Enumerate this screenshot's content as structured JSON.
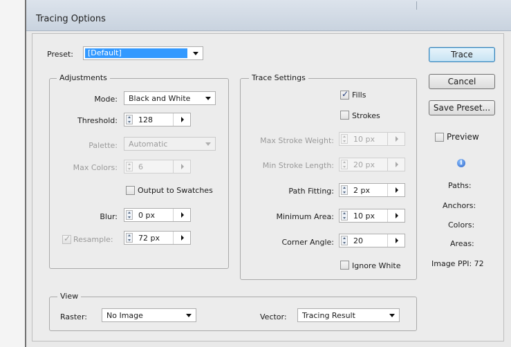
{
  "window": {
    "title": "Tracing Options"
  },
  "preset": {
    "label": "Preset:",
    "value": "[Default]"
  },
  "adjustments": {
    "title": "Adjustments",
    "mode": {
      "label": "Mode:",
      "value": "Black and White"
    },
    "threshold": {
      "label": "Threshold:",
      "value": "128"
    },
    "palette": {
      "label": "Palette:",
      "value": "Automatic"
    },
    "max_colors": {
      "label": "Max Colors:",
      "value": "6"
    },
    "output_to_swatches": {
      "label": "Output to Swatches",
      "checked": false
    },
    "blur": {
      "label": "Blur:",
      "value": "0 px"
    },
    "resample": {
      "label": "Resample:",
      "value": "72 px",
      "checked": true
    }
  },
  "trace_settings": {
    "title": "Trace Settings",
    "fills": {
      "label": "Fills",
      "checked": true
    },
    "strokes": {
      "label": "Strokes",
      "checked": false
    },
    "max_stroke_weight": {
      "label": "Max Stroke Weight:",
      "value": "10 px"
    },
    "min_stroke_length": {
      "label": "Min Stroke Length:",
      "value": "20 px"
    },
    "path_fitting": {
      "label": "Path Fitting:",
      "value": "2 px"
    },
    "minimum_area": {
      "label": "Minimum Area:",
      "value": "10 px"
    },
    "corner_angle": {
      "label": "Corner Angle:",
      "value": "20"
    },
    "ignore_white": {
      "label": "Ignore White",
      "checked": false
    }
  },
  "view": {
    "title": "View",
    "raster": {
      "label": "Raster:",
      "value": "No Image"
    },
    "vector": {
      "label": "Vector:",
      "value": "Tracing Result"
    }
  },
  "buttons": {
    "trace": "Trace",
    "cancel": "Cancel",
    "save_preset": "Save Preset..."
  },
  "preview": {
    "label": "Preview",
    "checked": false
  },
  "stats": {
    "paths": "Paths:",
    "anchors": "Anchors:",
    "colors": "Colors:",
    "areas": "Areas:",
    "image_ppi": "Image PPI: 72"
  },
  "colors": {
    "accent": "#3c7fb1",
    "selection": "#3399ff",
    "titlebar": "#c9d3df"
  },
  "icons": {
    "info": "info-icon",
    "dropdown": "chevron-down-icon",
    "spinner": "spinner-icon",
    "flyout": "arrow-right-icon"
  }
}
